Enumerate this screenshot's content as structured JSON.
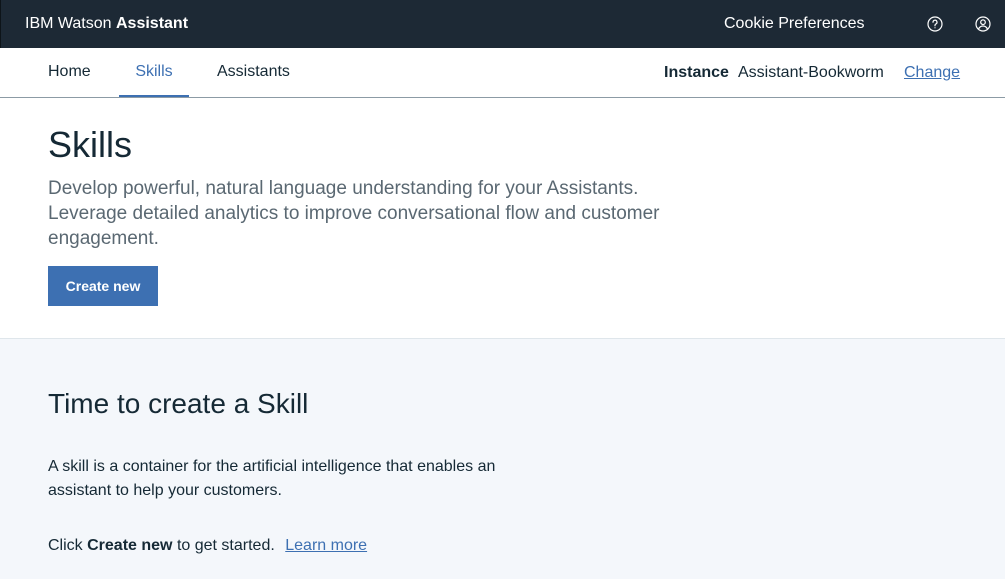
{
  "header": {
    "brand_prefix": "IBM Watson",
    "brand_name": "Assistant",
    "cookie_preferences": "Cookie Preferences",
    "help_icon": "help-circle-icon",
    "user_icon": "user-avatar-icon",
    "background_color": "#1d2935"
  },
  "nav": {
    "tabs": [
      {
        "label": "Home"
      },
      {
        "label": "Skills",
        "active": true
      },
      {
        "label": "Assistants"
      }
    ],
    "instance_label": "Instance",
    "instance_value": "Assistant-Bookworm",
    "change_label": "Change",
    "accent_color": "#3d70b2"
  },
  "hero": {
    "title": "Skills",
    "description": "Develop powerful, natural language understanding for your Assistants. Leverage detailed analytics to improve conversational flow and customer engagement.",
    "create_button": "Create new"
  },
  "empty_state": {
    "title": "Time to create a Skill",
    "description": "A skill is a container for the artificial intelligence that enables an assistant to help your customers.",
    "cta_prefix": "Click",
    "cta_bold": "Create new",
    "cta_suffix": "to get started.",
    "learn_more": "Learn more"
  }
}
